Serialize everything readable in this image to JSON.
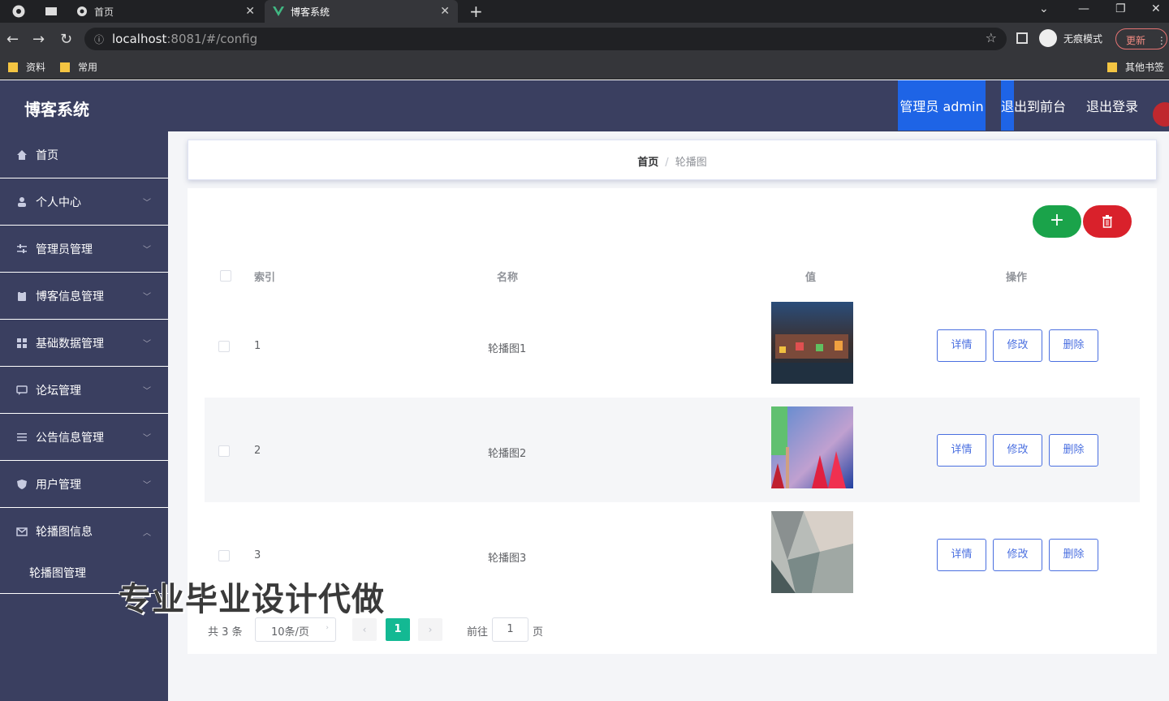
{
  "browser": {
    "tabs": [
      {
        "title": "首页",
        "active": false
      },
      {
        "title": "博客系统",
        "active": true
      }
    ],
    "url_host": "localhost",
    "url_rest": ":8081/#/config",
    "incognito_label": "无痕模式",
    "update_label": "更新",
    "bookmarks": [
      "资料",
      "常用"
    ],
    "other_bookmarks": "其他书签"
  },
  "header": {
    "title": "博客系统",
    "admin_label": "管理员 admin",
    "front_label": "退出到前台",
    "logout_label": "退出登录"
  },
  "sidebar": {
    "items": [
      {
        "label": "首页",
        "icon": "home-icon"
      },
      {
        "label": "个人中心",
        "icon": "user-icon"
      },
      {
        "label": "管理员管理",
        "icon": "sliders-icon"
      },
      {
        "label": "博客信息管理",
        "icon": "clipboard-icon"
      },
      {
        "label": "基础数据管理",
        "icon": "grid-icon"
      },
      {
        "label": "论坛管理",
        "icon": "chat-icon"
      },
      {
        "label": "公告信息管理",
        "icon": "list-icon"
      },
      {
        "label": "用户管理",
        "icon": "shield-icon"
      },
      {
        "label": "轮播图信息",
        "icon": "mail-icon"
      }
    ],
    "submenu_label": "轮播图管理"
  },
  "breadcrumb": {
    "home": "首页",
    "separator": "/",
    "current": "轮播图"
  },
  "table": {
    "headers": [
      "索引",
      "名称",
      "值",
      "操作"
    ],
    "rows": [
      {
        "index": "1",
        "name": "轮播图1"
      },
      {
        "index": "2",
        "name": "轮播图2"
      },
      {
        "index": "3",
        "name": "轮播图3"
      }
    ],
    "actions": [
      "详情",
      "修改",
      "删除"
    ]
  },
  "pagination": {
    "total": "共 3 条",
    "page_size": "10条/页",
    "current_page": "1",
    "goto_label": "前往",
    "goto_value": "1",
    "page_suffix": "页"
  },
  "watermark": "专业毕业设计代做",
  "colors": {
    "header_bg": "#3a3f60",
    "accent_blue": "#1e64e6",
    "add_green": "#1aa34a",
    "delete_red": "#d9212b",
    "page_active": "#13b993"
  }
}
